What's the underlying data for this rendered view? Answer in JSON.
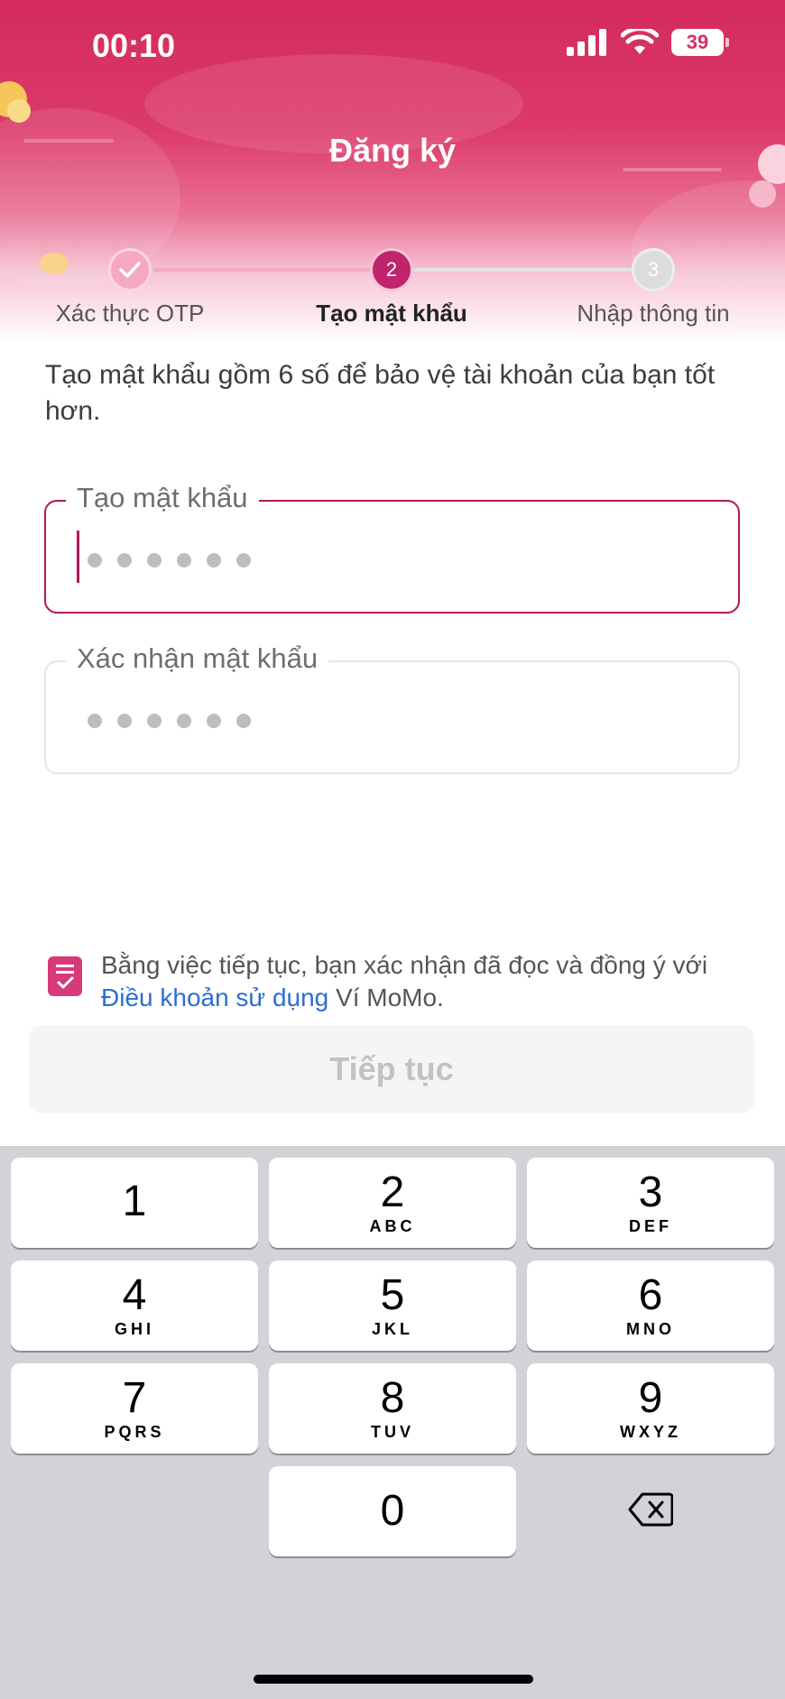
{
  "status_bar": {
    "time": "00:10",
    "battery": "39"
  },
  "header": {
    "title": "Đăng ký"
  },
  "stepper": {
    "steps": [
      {
        "number": "1",
        "label": "Xác thực OTP",
        "state": "done"
      },
      {
        "number": "2",
        "label": "Tạo mật khẩu",
        "state": "active"
      },
      {
        "number": "3",
        "label": "Nhập thông tin",
        "state": "pending"
      }
    ]
  },
  "description": "Tạo mật khẩu gồm 6 số để bảo vệ tài khoản của bạn tốt hơn.",
  "password_field": {
    "label": "Tạo mật khẩu",
    "digits": 6
  },
  "confirm_field": {
    "label": "Xác nhận mật khẩu",
    "digits": 6
  },
  "terms": {
    "prefix": "Bằng việc tiếp tục, bạn xác nhận đã đọc và đồng ý với ",
    "link": "Điều khoản sử dụng",
    "suffix": " Ví MoMo."
  },
  "continue_button": {
    "label": "Tiếp tục",
    "enabled": false
  },
  "keypad": {
    "keys": [
      {
        "num": "1",
        "letters": ""
      },
      {
        "num": "2",
        "letters": "ABC"
      },
      {
        "num": "3",
        "letters": "DEF"
      },
      {
        "num": "4",
        "letters": "GHI"
      },
      {
        "num": "5",
        "letters": "JKL"
      },
      {
        "num": "6",
        "letters": "MNO"
      },
      {
        "num": "7",
        "letters": "PQRS"
      },
      {
        "num": "8",
        "letters": "TUV"
      },
      {
        "num": "9",
        "letters": "WXYZ"
      },
      {
        "num": "0",
        "letters": ""
      }
    ],
    "delete_icon": "backspace-icon"
  },
  "colors": {
    "brand": "#d42a5e",
    "accent": "#b0175d",
    "link": "#2c6dd3",
    "disabled_text": "#c2c2c2"
  }
}
